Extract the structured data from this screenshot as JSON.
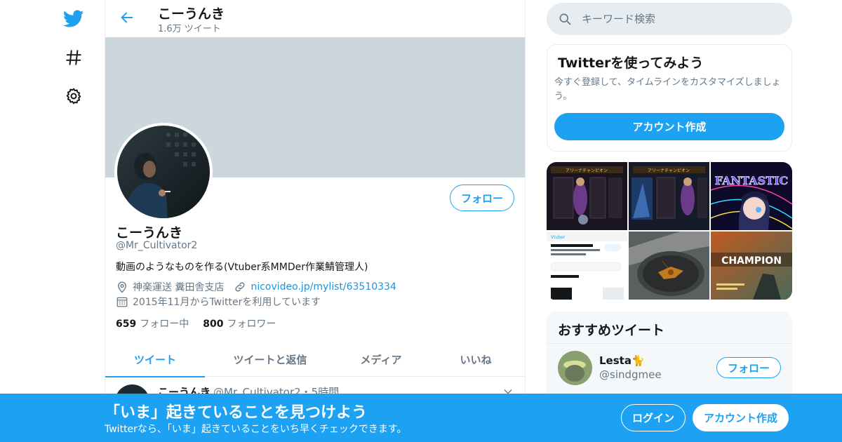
{
  "colors": {
    "accent": "#1da1f2",
    "banner": "#ccd6dd",
    "secondary_text": "#657786",
    "primary_text": "#14171a"
  },
  "left_nav": {
    "items": [
      {
        "icon": "twitter-bird-icon"
      },
      {
        "icon": "hashtag-icon"
      },
      {
        "icon": "gear-icon"
      }
    ]
  },
  "header": {
    "name": "こーうんき",
    "tweet_count": "1.6万 ツイート"
  },
  "profile": {
    "name": "こーうんき",
    "handle": "@Mr_Cultivator2",
    "bio": "動画のようなものを作る(Vtuber系MMDer作業鯖管理人)",
    "location": "神楽運送 糞田舎支店",
    "website": "nicovideo.jp/mylist/63510334",
    "joined": "2015年11月からTwitterを利用しています",
    "following_count": "659",
    "following_label": "フォロー中",
    "followers_count": "800",
    "followers_label": "フォロワー",
    "follow_button": "フォロー"
  },
  "tabs": [
    {
      "label": "ツイート",
      "active": true
    },
    {
      "label": "ツイートと返信",
      "active": false
    },
    {
      "label": "メディア",
      "active": false
    },
    {
      "label": "いいね",
      "active": false
    }
  ],
  "tweet_preview": {
    "name": "こーうんき",
    "handle_time": "@Mr_Cultivator2・5時間"
  },
  "search": {
    "placeholder": "キーワード検索"
  },
  "signup_card": {
    "title": "Twitterを使ってみよう",
    "text": "今すぐ登録して、タイムラインをカスタマイズしましょう。",
    "button": "アカウント作成"
  },
  "media_grid": {
    "tiles": [
      {
        "caption": "アリーナチャンピオン"
      },
      {
        "caption": "アリーナチャンピオン"
      },
      {
        "caption": "FANTASTIC"
      },
      {
        "caption": "Vtuber"
      },
      {
        "caption": ""
      },
      {
        "caption": "CHAMPION"
      }
    ]
  },
  "recommended": {
    "title": "おすすめツイート",
    "user_name": "Lesta🐈",
    "user_handle": "@sindgmee",
    "follow_button": "フォロー"
  },
  "bottom_banner": {
    "title": "「いま」起きていることを見つけよう",
    "subtitle": "Twitterなら、「いま」起きていることをいち早くチェックできます。",
    "login_button": "ログイン",
    "signup_button": "アカウント作成"
  }
}
